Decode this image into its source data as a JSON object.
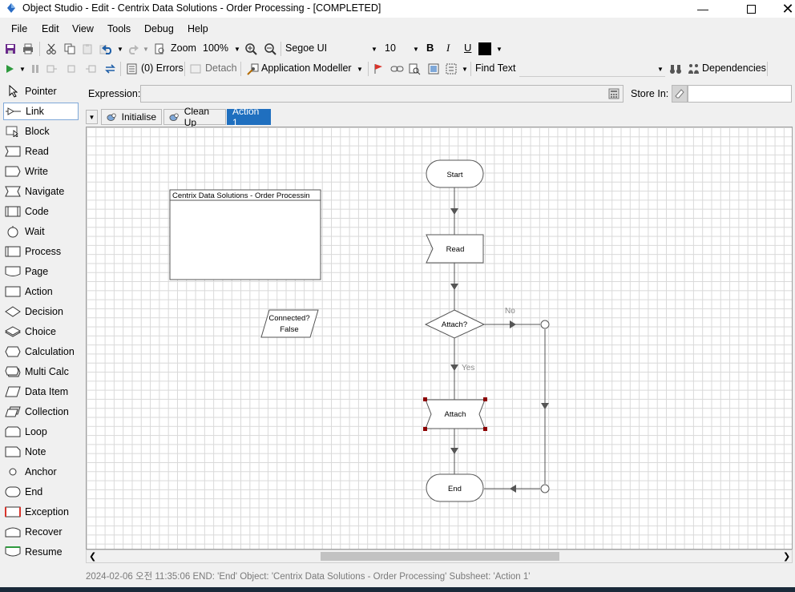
{
  "window": {
    "title": "Object Studio  - Edit - Centrix Data Solutions - Order Processing - [COMPLETED]"
  },
  "menu": [
    "File",
    "Edit",
    "View",
    "Tools",
    "Debug",
    "Help"
  ],
  "toolbar1": {
    "zoom_label": "Zoom",
    "zoom_value": "100%",
    "font_name": "Segoe UI",
    "font_size": "10",
    "bold": "B",
    "italic": "I",
    "underline": "U",
    "color_hex": "#000000"
  },
  "toolbar2": {
    "errors": "(0) Errors",
    "detach": "Detach",
    "app_modeller": "Application Modeller",
    "find_text": "Find Text",
    "dependencies": "Dependencies"
  },
  "palette": [
    "Pointer",
    "Link",
    "Block",
    "Read",
    "Write",
    "Navigate",
    "Code",
    "Wait",
    "Process",
    "Page",
    "Action",
    "Decision",
    "Choice",
    "Calculation",
    "Multi Calc",
    "Data Item",
    "Collection",
    "Loop",
    "Note",
    "Anchor",
    "End",
    "Exception",
    "Recover",
    "Resume"
  ],
  "palette_selected": "Link",
  "expression": {
    "label": "Expression:",
    "value": "",
    "store_label": "Store In:",
    "store_value": ""
  },
  "tabs": [
    {
      "label": "Initialise",
      "active": false
    },
    {
      "label": "Clean Up",
      "active": false
    },
    {
      "label": "Action 1",
      "active": true
    }
  ],
  "diagram": {
    "block_title": "Centrix Data Solutions - Order Processin",
    "data_item": {
      "name": "Connected?",
      "value": "False"
    },
    "nodes": {
      "start": "Start",
      "read": "Read",
      "decision": "Attach?",
      "attach": "Attach",
      "end": "End"
    },
    "edge_no": "No",
    "edge_yes": "Yes"
  },
  "status": "2024-02-06 오전 11:35:06 END: 'End' Object: 'Centrix Data Solutions - Order Processing' Subsheet: 'Action 1'",
  "colors": {
    "accent": "#1f6fbf",
    "selection_handle": "#8b0000",
    "exception": "#d9342b"
  }
}
